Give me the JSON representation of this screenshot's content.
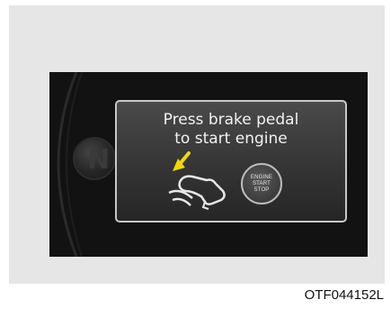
{
  "display": {
    "message_line1": "Press brake pedal",
    "message_line2": "to start engine",
    "shift_indicator": "N",
    "start_button": {
      "line1": "ENGINE",
      "line2": "START",
      "line3": "STOP"
    },
    "icons": [
      "brake-pedal-icon",
      "arrow-icon"
    ],
    "colors": {
      "arrow": "#f5d800",
      "screen_border": "#c8c8c8",
      "text": "#f2f2f2"
    }
  },
  "figure_code": "OTF044152L"
}
